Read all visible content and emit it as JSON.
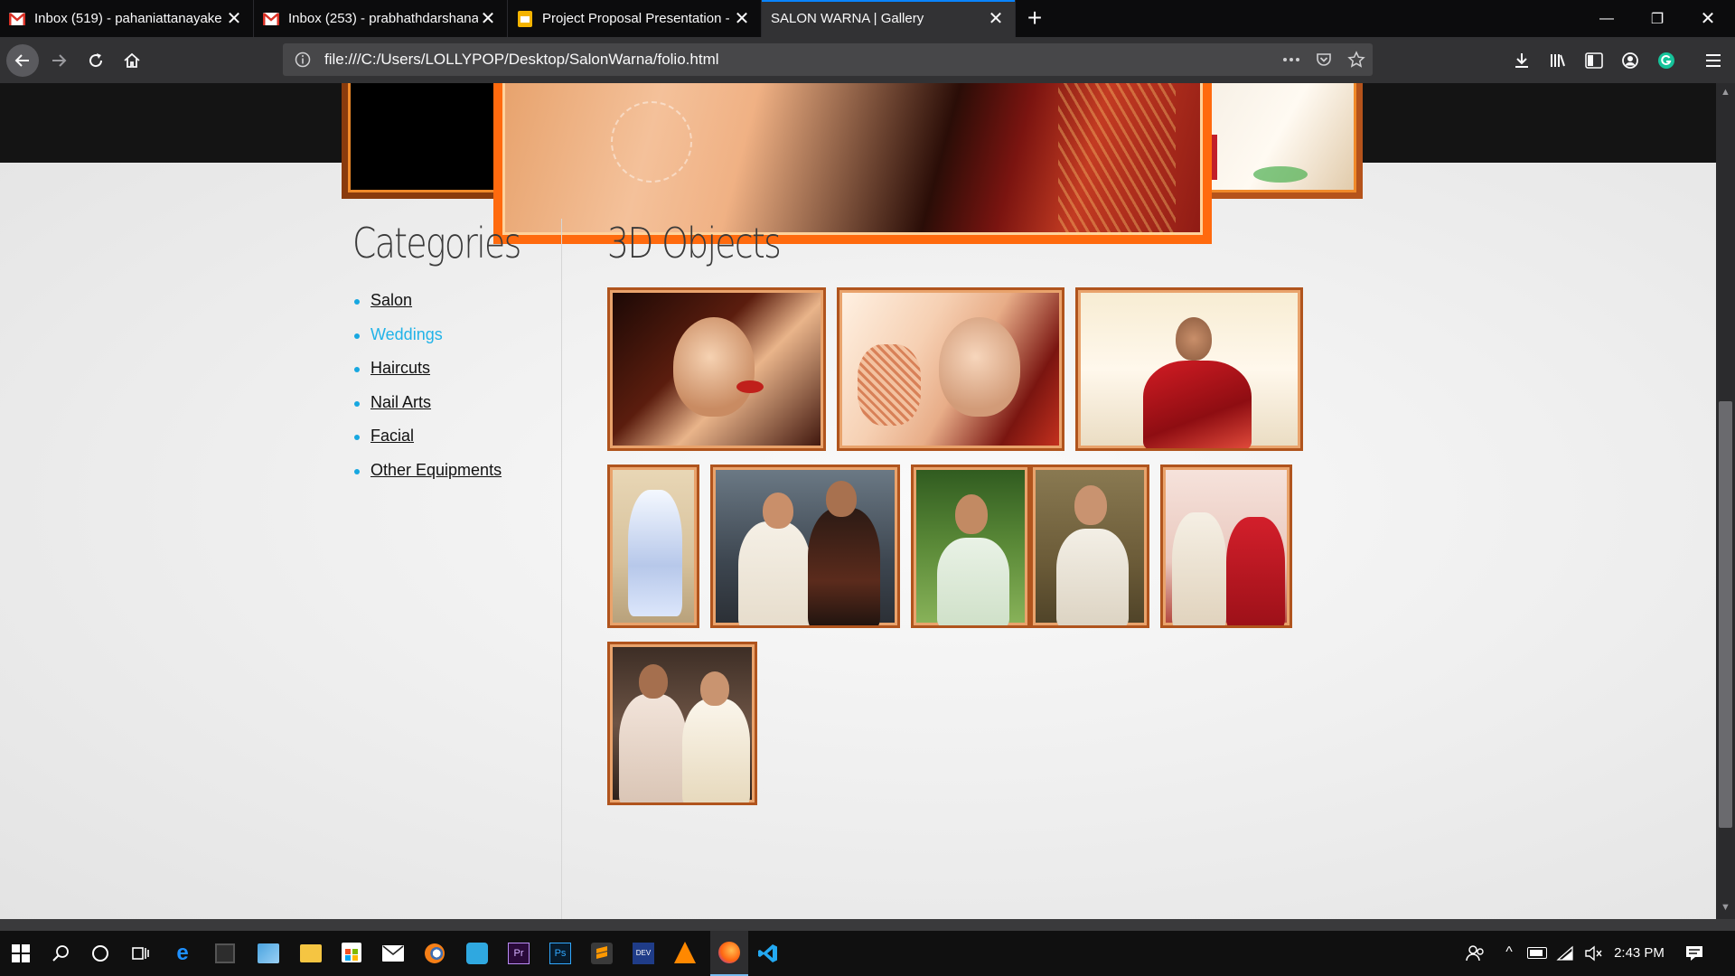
{
  "browser": {
    "tabs": [
      {
        "title": "Inbox (519) - pahaniattanayake",
        "favicon": "gmail-icon",
        "active": false
      },
      {
        "title": "Inbox (253) - prabhathdarshana",
        "favicon": "gmail-icon",
        "active": false
      },
      {
        "title": "Project Proposal Presentation -",
        "favicon": "slides-icon",
        "active": false
      },
      {
        "title": "SALON WARNA | Gallery",
        "favicon": "none",
        "active": true
      }
    ],
    "url": "file:///C:/Users/LOLLYPOP/Desktop/SalonWarna/folio.html",
    "accent": "#0a84ff"
  },
  "page": {
    "sidebar": {
      "heading": "Categories",
      "items": [
        {
          "label": "Salon",
          "active": false
        },
        {
          "label": "Weddings",
          "active": true
        },
        {
          "label": "Haircuts",
          "active": false
        },
        {
          "label": "Nail Arts",
          "active": false
        },
        {
          "label": "Facial",
          "active": false
        },
        {
          "label": "Other Equipments",
          "active": false
        }
      ]
    },
    "content": {
      "heading": "3D Objects",
      "gallery_count": 9
    },
    "colors": {
      "frame": "#b0541d",
      "frame_inner": "#e9a36c",
      "hero_frame": "#ff6a0e",
      "link_active": "#21b3e8",
      "bullet": "#17a7e0"
    }
  },
  "taskbar": {
    "time": "2:43 PM",
    "apps": [
      "windows-start-icon",
      "search-icon",
      "cortana-icon",
      "task-view-icon",
      "edge-icon",
      "calculator-icon",
      "photos-icon",
      "file-explorer-icon",
      "store-icon",
      "mail-icon",
      "blender-icon",
      "vpn-icon",
      "premiere-icon",
      "photoshop-icon",
      "sublime-icon",
      "devcpp-icon",
      "vlc-icon",
      "firefox-icon",
      "vscode-icon"
    ]
  }
}
